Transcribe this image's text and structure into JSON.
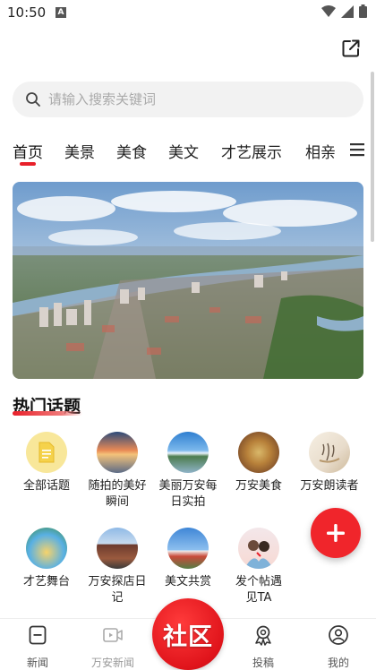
{
  "status_bar": {
    "time": "10:50",
    "notification_glyph": "A"
  },
  "search": {
    "placeholder": "请输入搜索关键词"
  },
  "tabs": [
    {
      "label": "首页",
      "active": true
    },
    {
      "label": "美景"
    },
    {
      "label": "美食"
    },
    {
      "label": "美文"
    },
    {
      "label": "才艺展示"
    },
    {
      "label": "相亲"
    }
  ],
  "hot_topics": {
    "title": "热门话题",
    "items": [
      {
        "label": "全部话题",
        "icon": "document-icon"
      },
      {
        "label": "随拍的美好瞬间"
      },
      {
        "label": "美丽万安每日实拍"
      },
      {
        "label": "万安美食"
      },
      {
        "label": "万安朗读者"
      },
      {
        "label": "才艺舞台"
      },
      {
        "label": "万安探店日记"
      },
      {
        "label": "美文共赏"
      },
      {
        "label": "发个帖遇见TA"
      }
    ]
  },
  "bottom_nav": {
    "items": [
      {
        "label": "新闻",
        "icon": "news-icon"
      },
      {
        "label": "万安新闻",
        "icon": "video-icon"
      },
      {
        "label": "投稿",
        "icon": "submit-icon"
      },
      {
        "label": "我的",
        "icon": "user-icon"
      }
    ],
    "center_label": "社区"
  },
  "colors": {
    "accent": "#e8202a",
    "search_bg": "#f2f2f2"
  }
}
